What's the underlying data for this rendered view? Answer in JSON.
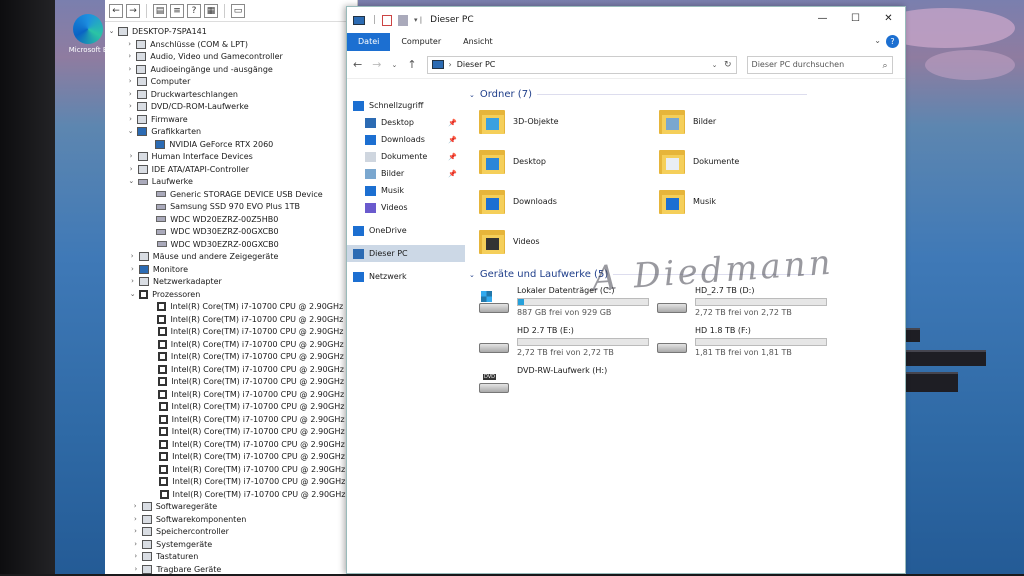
{
  "desktop": {
    "icon_label": "Microsoft E"
  },
  "device_manager": {
    "tree": [
      {
        "label": "DESKTOP-7SPA141",
        "level": 0,
        "arrow": "⌄",
        "icon": "computer"
      },
      {
        "label": "Anschlüsse (COM & LPT)",
        "level": 1,
        "arrow": "›",
        "icon": "port"
      },
      {
        "label": "Audio, Video und Gamecontroller",
        "level": 1,
        "arrow": "›",
        "icon": "audio"
      },
      {
        "label": "Audioeingänge und -ausgänge",
        "level": 1,
        "arrow": "›",
        "icon": "audio"
      },
      {
        "label": "Computer",
        "level": 1,
        "arrow": "›",
        "icon": "computer"
      },
      {
        "label": "Druckwarteschlangen",
        "level": 1,
        "arrow": "›",
        "icon": "printer"
      },
      {
        "label": "DVD/CD-ROM-Laufwerke",
        "level": 1,
        "arrow": "›",
        "icon": "dvd"
      },
      {
        "label": "Firmware",
        "level": 1,
        "arrow": "›",
        "icon": "chip"
      },
      {
        "label": "Grafikkarten",
        "level": 1,
        "arrow": "⌄",
        "icon": "monitor"
      },
      {
        "label": "NVIDIA GeForce RTX 2060",
        "level": 2,
        "arrow": "",
        "icon": "monitor"
      },
      {
        "label": "Human Interface Devices",
        "level": 1,
        "arrow": "›",
        "icon": "hid"
      },
      {
        "label": "IDE ATA/ATAPI-Controller",
        "level": 1,
        "arrow": "›",
        "icon": "chip"
      },
      {
        "label": "Laufwerke",
        "level": 1,
        "arrow": "⌄",
        "icon": "disk"
      },
      {
        "label": "Generic STORAGE DEVICE USB Device",
        "level": 2,
        "arrow": "",
        "icon": "disk"
      },
      {
        "label": "Samsung SSD 970 EVO Plus 1TB",
        "level": 2,
        "arrow": "",
        "icon": "disk"
      },
      {
        "label": "WDC WD20EZRZ-00Z5HB0",
        "level": 2,
        "arrow": "",
        "icon": "disk"
      },
      {
        "label": "WDC WD30EZRZ-00GXCB0",
        "level": 2,
        "arrow": "",
        "icon": "disk"
      },
      {
        "label": "WDC WD30EZRZ-00GXCB0",
        "level": 2,
        "arrow": "",
        "icon": "disk"
      },
      {
        "label": "Mäuse und andere Zeigegeräte",
        "level": 1,
        "arrow": "›",
        "icon": "mouse"
      },
      {
        "label": "Monitore",
        "level": 1,
        "arrow": "›",
        "icon": "monitor"
      },
      {
        "label": "Netzwerkadapter",
        "level": 1,
        "arrow": "›",
        "icon": "network"
      },
      {
        "label": "Prozessoren",
        "level": 1,
        "arrow": "⌄",
        "icon": "cpu"
      },
      {
        "label": "Intel(R) Core(TM) i7-10700 CPU @ 2.90GHz",
        "level": 2,
        "arrow": "",
        "icon": "cpu"
      },
      {
        "label": "Intel(R) Core(TM) i7-10700 CPU @ 2.90GHz",
        "level": 2,
        "arrow": "",
        "icon": "cpu"
      },
      {
        "label": "Intel(R) Core(TM) i7-10700 CPU @ 2.90GHz",
        "level": 2,
        "arrow": "",
        "icon": "cpu"
      },
      {
        "label": "Intel(R) Core(TM) i7-10700 CPU @ 2.90GHz",
        "level": 2,
        "arrow": "",
        "icon": "cpu"
      },
      {
        "label": "Intel(R) Core(TM) i7-10700 CPU @ 2.90GHz",
        "level": 2,
        "arrow": "",
        "icon": "cpu"
      },
      {
        "label": "Intel(R) Core(TM) i7-10700 CPU @ 2.90GHz",
        "level": 2,
        "arrow": "",
        "icon": "cpu"
      },
      {
        "label": "Intel(R) Core(TM) i7-10700 CPU @ 2.90GHz",
        "level": 2,
        "arrow": "",
        "icon": "cpu"
      },
      {
        "label": "Intel(R) Core(TM) i7-10700 CPU @ 2.90GHz",
        "level": 2,
        "arrow": "",
        "icon": "cpu"
      },
      {
        "label": "Intel(R) Core(TM) i7-10700 CPU @ 2.90GHz",
        "level": 2,
        "arrow": "",
        "icon": "cpu"
      },
      {
        "label": "Intel(R) Core(TM) i7-10700 CPU @ 2.90GHz",
        "level": 2,
        "arrow": "",
        "icon": "cpu"
      },
      {
        "label": "Intel(R) Core(TM) i7-10700 CPU @ 2.90GHz",
        "level": 2,
        "arrow": "",
        "icon": "cpu"
      },
      {
        "label": "Intel(R) Core(TM) i7-10700 CPU @ 2.90GHz",
        "level": 2,
        "arrow": "",
        "icon": "cpu"
      },
      {
        "label": "Intel(R) Core(TM) i7-10700 CPU @ 2.90GHz",
        "level": 2,
        "arrow": "",
        "icon": "cpu"
      },
      {
        "label": "Intel(R) Core(TM) i7-10700 CPU @ 2.90GHz",
        "level": 2,
        "arrow": "",
        "icon": "cpu"
      },
      {
        "label": "Intel(R) Core(TM) i7-10700 CPU @ 2.90GHz",
        "level": 2,
        "arrow": "",
        "icon": "cpu"
      },
      {
        "label": "Intel(R) Core(TM) i7-10700 CPU @ 2.90GHz",
        "level": 2,
        "arrow": "",
        "icon": "cpu"
      },
      {
        "label": "Softwaregeräte",
        "level": 1,
        "arrow": "›",
        "icon": "chip"
      },
      {
        "label": "Softwarekomponenten",
        "level": 1,
        "arrow": "›",
        "icon": "chip"
      },
      {
        "label": "Speichercontroller",
        "level": 1,
        "arrow": "›",
        "icon": "chip"
      },
      {
        "label": "Systemgeräte",
        "level": 1,
        "arrow": "›",
        "icon": "chip"
      },
      {
        "label": "Tastaturen",
        "level": 1,
        "arrow": "›",
        "icon": "keyboard"
      },
      {
        "label": "Tragbare Geräte",
        "level": 1,
        "arrow": "›",
        "icon": "chip"
      }
    ]
  },
  "explorer": {
    "title": "Dieser PC",
    "ribbon_tabs": [
      "Datei",
      "Computer",
      "Ansicht"
    ],
    "address": "Dieser PC",
    "search_placeholder": "Dieser PC durchsuchen",
    "nav_items": [
      {
        "label": "Schnellzugriff",
        "icon": "star-icon",
        "pinned": false
      },
      {
        "label": "Desktop",
        "icon": "desktop-icon",
        "pinned": true
      },
      {
        "label": "Downloads",
        "icon": "download-icon",
        "pinned": true
      },
      {
        "label": "Dokumente",
        "icon": "document-icon",
        "pinned": true
      },
      {
        "label": "Bilder",
        "icon": "picture-icon",
        "pinned": true
      },
      {
        "label": "Musik",
        "icon": "music-icon",
        "pinned": false
      },
      {
        "label": "Videos",
        "icon": "video-icon",
        "pinned": false
      },
      {
        "label": "OneDrive",
        "icon": "cloud-icon",
        "pinned": false
      },
      {
        "label": "Dieser PC",
        "icon": "pc-icon",
        "pinned": false
      },
      {
        "label": "Netzwerk",
        "icon": "network-icon",
        "pinned": false
      }
    ],
    "folders_header": "Ordner (7)",
    "folders": [
      {
        "label": "3D-Objekte",
        "mark": "cube"
      },
      {
        "label": "Bilder",
        "mark": "picture"
      },
      {
        "label": "Desktop",
        "mark": "desktop"
      },
      {
        "label": "Dokumente",
        "mark": "document"
      },
      {
        "label": "Downloads",
        "mark": "download"
      },
      {
        "label": "Musik",
        "mark": "music"
      },
      {
        "label": "Videos",
        "mark": "video"
      }
    ],
    "drives_header": "Geräte und Laufwerke (5)",
    "drives": [
      {
        "name": "Lokaler Datenträger (C:)",
        "free": "887 GB frei von 929 GB",
        "used_fraction": 0.045,
        "type": "windows"
      },
      {
        "name": "HD_2.7 TB (D:)",
        "free": "2,72 TB frei von 2,72 TB",
        "used_fraction": 0.0,
        "type": "hdd"
      },
      {
        "name": "HD 2.7 TB (E:)",
        "free": "2,72 TB frei von 2,72 TB",
        "used_fraction": 0.0,
        "type": "hdd"
      },
      {
        "name": "HD 1.8 TB (F:)",
        "free": "1,81 TB frei von 1,81 TB",
        "used_fraction": 0.0,
        "type": "hdd"
      },
      {
        "name": "DVD-RW-Laufwerk (H:)",
        "free": "",
        "used_fraction": null,
        "type": "dvd"
      }
    ],
    "dvd_label": "DVD",
    "accent": "#1c6fd1"
  }
}
